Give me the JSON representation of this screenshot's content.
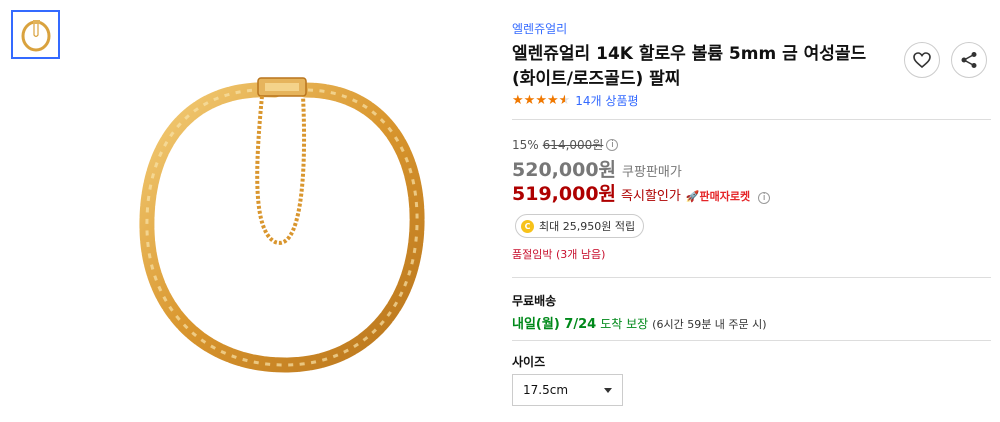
{
  "product": {
    "brand": "엘렌쥬얼리",
    "title": "엘렌쥬얼리 14K 할로우 볼륨 5mm 금 여성골드(화이트/로즈골드) 팔찌",
    "rating": 4.5,
    "review_count_label": "14개 상품평"
  },
  "pricing": {
    "discount_rate": "15%",
    "original_price": "614,000원",
    "coupang_price": "520,000원",
    "coupang_price_label": "쿠팡판매가",
    "instant_discount_price": "519,000원",
    "instant_discount_label": "즉시할인가",
    "seller_rocket_badge": "🚀판매자로켓",
    "info_icon_glyph": "i"
  },
  "cashback": {
    "coin_glyph": "C",
    "label": "최대 25,950원 적립"
  },
  "stock_status": "품절임박 (3개 남음)",
  "shipping": {
    "title": "무료배송",
    "arrival_date": "내일(월) 7/24",
    "arrival_guarantee": "도착 보장",
    "cutoff_note": "(6시간 59분 내 주문 시)"
  },
  "options": {
    "size_label": "사이즈",
    "size_selected": "17.5cm"
  },
  "icons": {
    "heart": "heart-icon",
    "share": "share-icon"
  },
  "colors": {
    "accent_blue": "#346aff",
    "price_red": "#ae0000",
    "arrival_green": "#00891a",
    "star_orange": "#f07800",
    "gold": "#d9a23e"
  }
}
